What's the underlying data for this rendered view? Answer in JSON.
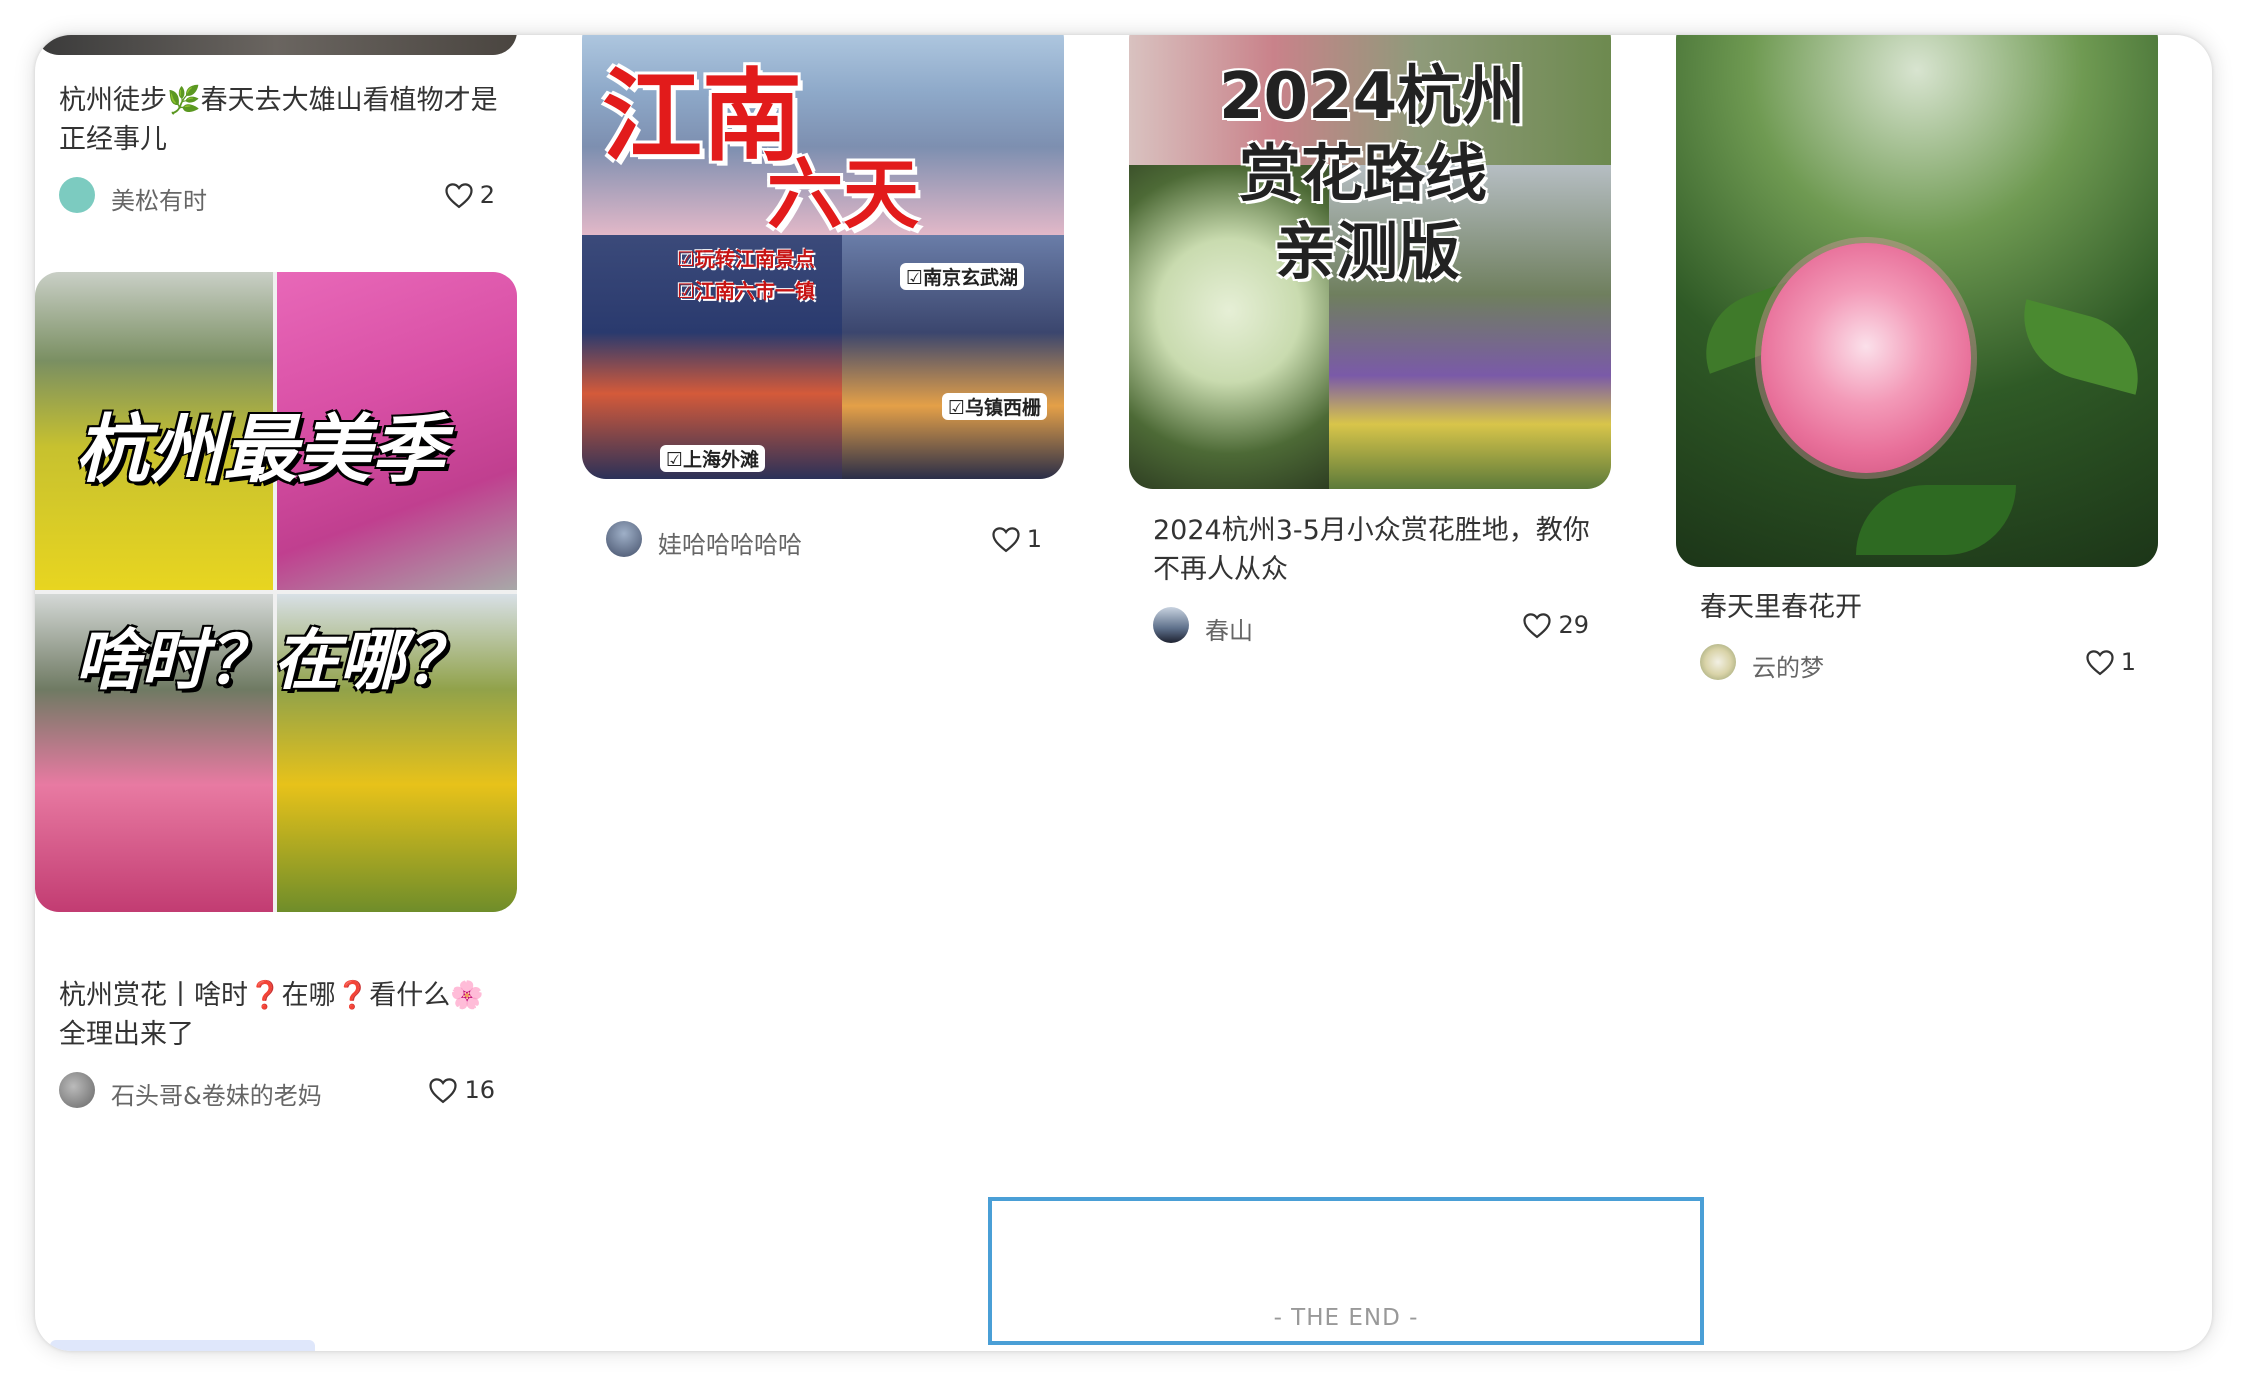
{
  "feed": {
    "cards": [
      {
        "title": "杭州徒步🌿春天去大雄山看植物才是正经事儿",
        "author": "美松有时",
        "likes": "2"
      },
      {
        "title": "杭州赏花丨啥时❓在哪❓看什么🌸全理出来了",
        "author": "石头哥&卷妹的老妈",
        "likes": "16",
        "cover_text": {
          "line1": "杭州最美季",
          "line2": "啥时？在哪？"
        }
      },
      {
        "author": "娃哈哈哈哈哈",
        "likes": "1",
        "cover_text": {
          "big1": "江南",
          "big2": "六天",
          "tag1": "☑玩转江南景点",
          "tag2": "☑江南六市一镇",
          "tag3": "☑南京玄武湖",
          "tag4": "☑乌镇西栅",
          "tag5": "☑上海外滩"
        }
      },
      {
        "title": "2024杭州3-5月小众赏花胜地，教你不再人从众",
        "author": "春山",
        "likes": "29",
        "cover_text": {
          "line1": "2024杭州",
          "line2": "赏花路线",
          "line3": "亲测版"
        }
      },
      {
        "title": "春天里春花开",
        "author": "云的梦",
        "likes": "1"
      }
    ]
  },
  "footer": {
    "end_label": "- THE END -"
  },
  "colors": {
    "accent_border": "#4a9fd6",
    "text_primary": "#333333",
    "text_secondary": "#666666"
  },
  "icons": [
    "heart-icon",
    "avatar"
  ]
}
